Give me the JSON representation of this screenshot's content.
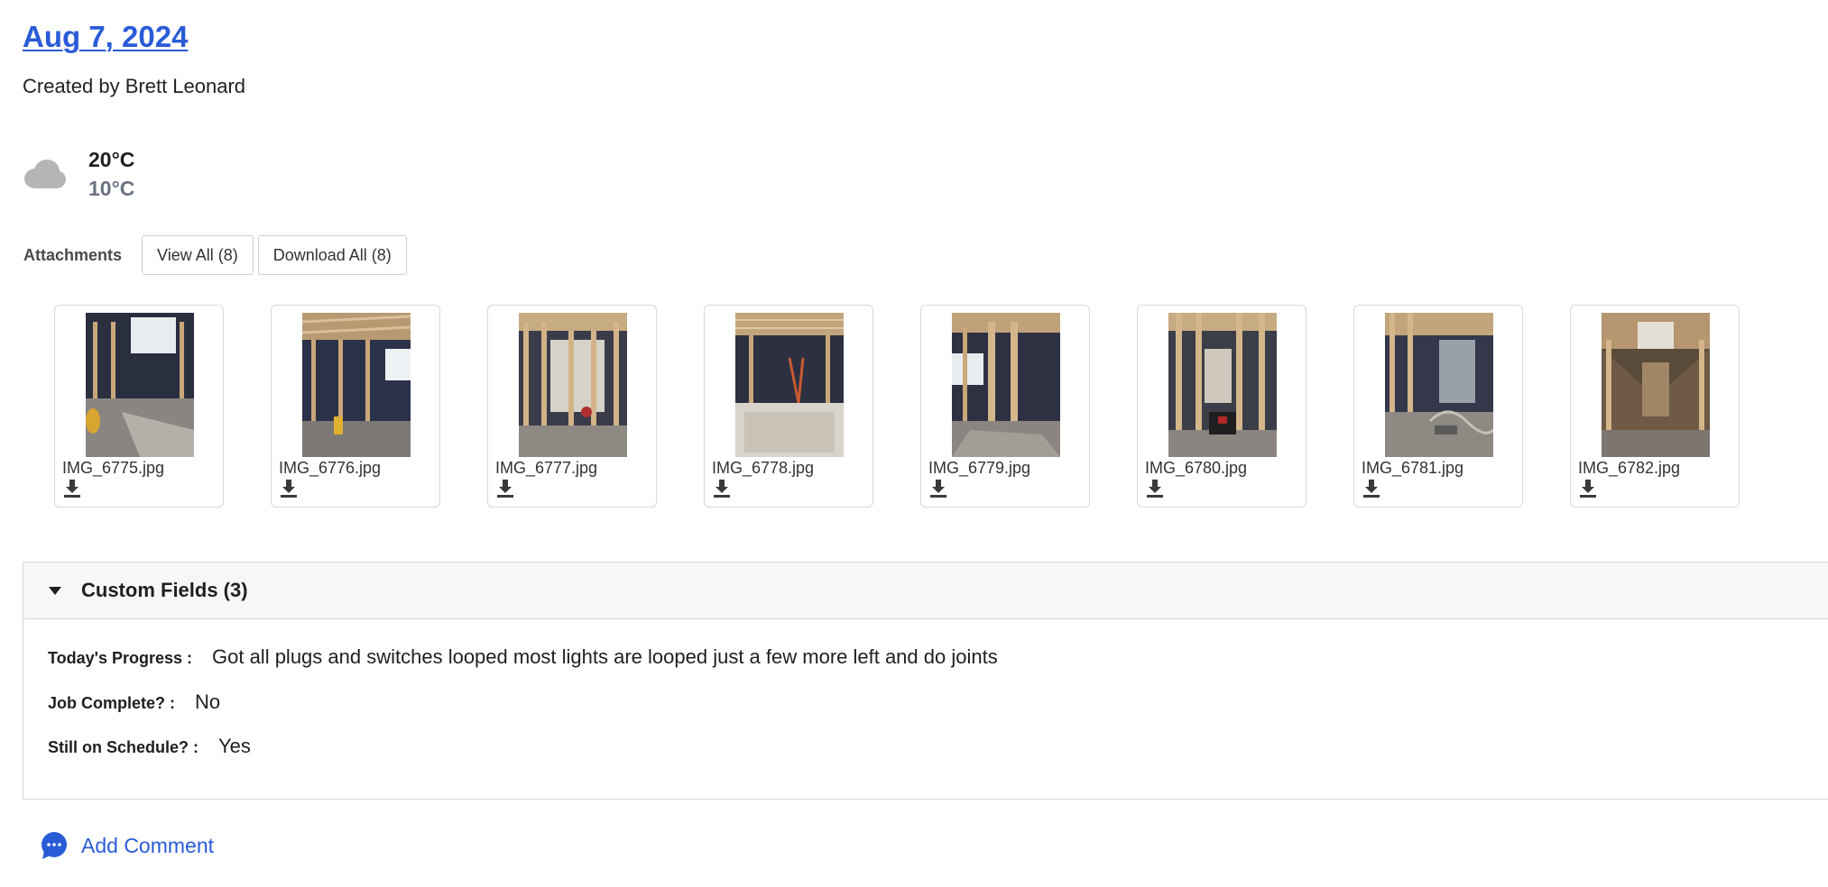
{
  "header": {
    "date_title": "Aug 7, 2024",
    "created_by": "Created by Brett Leonard"
  },
  "weather": {
    "icon": "cloud-icon",
    "high": "20°C",
    "low": "10°C"
  },
  "attachments": {
    "label": "Attachments",
    "view_all_label": "View All (8)",
    "download_all_label": "Download All (8)",
    "files": [
      {
        "name": "IMG_6775.jpg"
      },
      {
        "name": "IMG_6776.jpg"
      },
      {
        "name": "IMG_6777.jpg"
      },
      {
        "name": "IMG_6778.jpg"
      },
      {
        "name": "IMG_6779.jpg"
      },
      {
        "name": "IMG_6780.jpg"
      },
      {
        "name": "IMG_6781.jpg"
      },
      {
        "name": "IMG_6782.jpg"
      }
    ]
  },
  "custom_fields": {
    "title": "Custom Fields (3)",
    "fields": [
      {
        "label": "Today's Progress :",
        "value": "Got all plugs and switches looped most lights are looped just a few more left and do joints"
      },
      {
        "label": "Job Complete? :",
        "value": "No"
      },
      {
        "label": "Still on Schedule? :",
        "value": "Yes"
      }
    ]
  },
  "comments": {
    "add_label": "Add Comment",
    "icon": "comment-icon"
  },
  "colors": {
    "link": "#2a5bd7",
    "cloud": "#b5b5b5",
    "muted_temp": "#6b7280",
    "panel_header_bg": "#f7f7f8"
  }
}
